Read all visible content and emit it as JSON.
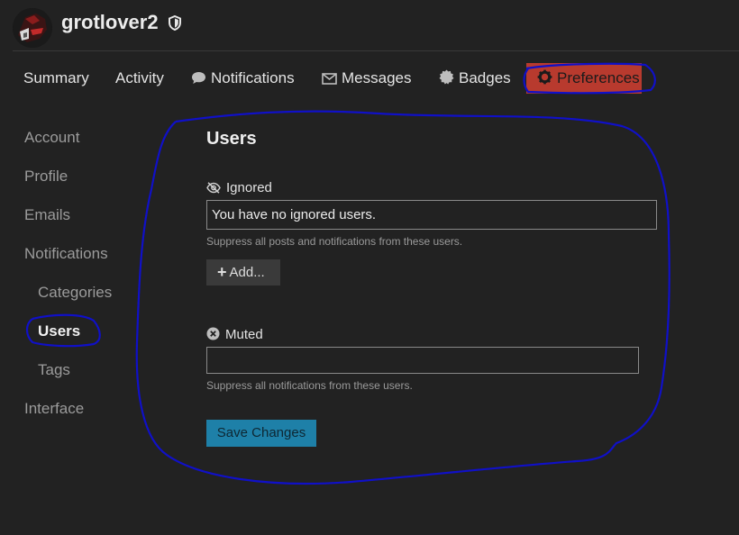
{
  "user": {
    "username": "grotlover2"
  },
  "top_nav": {
    "items": [
      {
        "label": "Summary",
        "icon": ""
      },
      {
        "label": "Activity",
        "icon": ""
      },
      {
        "label": "Notifications",
        "icon": "speech-bubble-icon"
      },
      {
        "label": "Messages",
        "icon": "envelope-icon"
      },
      {
        "label": "Badges",
        "icon": "badge-icon"
      },
      {
        "label": "Preferences",
        "icon": "gear-icon",
        "active": true
      }
    ]
  },
  "sidebar": {
    "items": [
      {
        "label": "Account"
      },
      {
        "label": "Profile"
      },
      {
        "label": "Emails"
      },
      {
        "label": "Notifications"
      },
      {
        "label": "Categories",
        "sub": true
      },
      {
        "label": "Users",
        "sub": true,
        "current": true
      },
      {
        "label": "Tags",
        "sub": true
      },
      {
        "label": "Interface"
      }
    ]
  },
  "main": {
    "title": "Users",
    "ignored": {
      "label": "Ignored",
      "icon": "eye-slash-icon",
      "value": "You have no ignored users.",
      "hint": "Suppress all posts and notifications from these users.",
      "add_label": "Add..."
    },
    "muted": {
      "label": "Muted",
      "icon": "x-circle-icon",
      "value": "",
      "hint": "Suppress all notifications from these users."
    },
    "save_label": "Save Changes"
  },
  "colors": {
    "background": "#222222",
    "active_tab": "#b83a2e",
    "save_button": "#1e80a8",
    "annotation": "#1010c8"
  }
}
